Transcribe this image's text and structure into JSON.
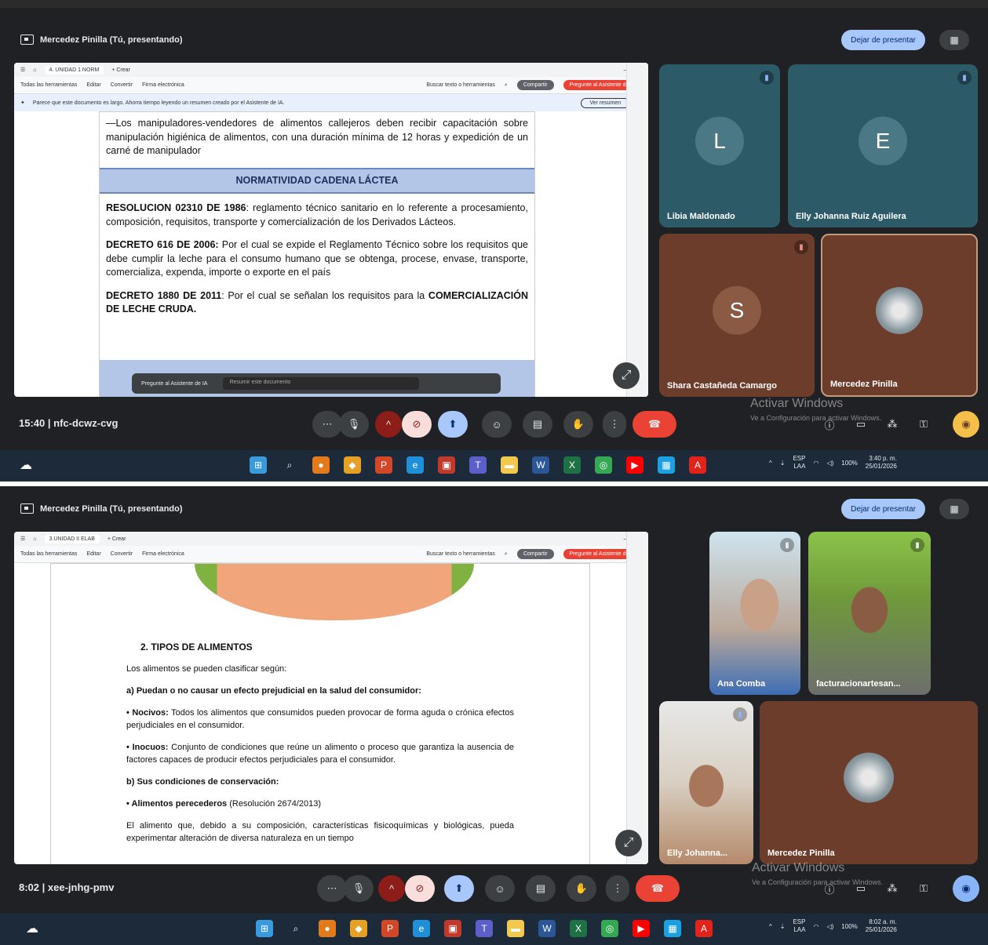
{
  "meeting_top": {
    "presenter_label": "Mercedez Pinilla (Tú, presentando)",
    "stop_presenting": "Dejar de presentar",
    "pdf": {
      "tab_label": "4. UNIDAD 1 NORM",
      "new_tab": "+ Crear",
      "toolbar_items": [
        "Todas las herramientas",
        "Editar",
        "Convertir",
        "Firma electrónica"
      ],
      "search_placeholder": "Buscar texto o herramientas",
      "share": "Compartir",
      "ask_ai": "Pregunte al Asistente de IA",
      "notice": "Parece que este documento es largo. Ahorra tiempo leyendo un resumen creado por el Asistente de IA.",
      "notice_button": "Ver resumen",
      "ask_bar_label": "Pregunte al Asistente de IA",
      "ask_bar_placeholder": "Resumir este documento"
    },
    "doc": {
      "intro": "—Los manipuladores-vendedores de alimentos callejeros deben recibir capacitación sobre manipulación higiénica de alimentos, con una duración mínima de 12 horas y expedición de un carné de manipulador",
      "heading": "NORMATIVIDAD CADENA LÁCTEA",
      "items": [
        {
          "bold": "RESOLUCION 02310 DE 1986",
          "text": ": reglamento técnico sanitario en lo referente a procesamiento, composición, requisitos, transporte y comercialización de los Derivados Lácteos."
        },
        {
          "bold": "DECRETO 616 DE 2006:",
          "text": " Por el cual se expide el Reglamento Técnico sobre los requisitos que debe cumplir la leche para el consumo humano que se obtenga, procese, envase, transporte, comercializa, expenda, importe o exporte en el país"
        },
        {
          "bold": "DECRETO 1880 DE 2011",
          "text": ": Por el cual se señalan los requisitos para la ",
          "bold2": "COMERCIALIZACIÓN DE LECHE CRUDA."
        }
      ]
    },
    "participants": [
      {
        "initial": "L",
        "name": "Libia Maldonado",
        "color": "#2d5a67"
      },
      {
        "initial": "E",
        "name": "Elly Johanna Ruiz Aguilera",
        "color": "#2d5a67"
      },
      {
        "initial": "S",
        "name": "Shara Castañeda Camargo",
        "color": "#6b3d2a"
      },
      {
        "initial": "",
        "name": "Mercedez Pinilla",
        "color": "#6b3d2a"
      }
    ],
    "time": "15:40",
    "meeting_code": "nfc-dcwz-cvg",
    "watermark_title": "Activar Windows",
    "watermark_sub": "Ve a Configuración para activar Windows.",
    "tray": {
      "lang1": "ESP",
      "lang2": "LAA",
      "battery": "100%",
      "clock_time": "3:40 p. m.",
      "clock_date": "25/01/2026"
    }
  },
  "meeting_bottom": {
    "presenter_label": "Mercedez Pinilla (Tú, presentando)",
    "stop_presenting": "Dejar de presentar",
    "pdf": {
      "tab_label": "3.UNIDAD II ELAB",
      "new_tab": "+ Crear",
      "toolbar_items": [
        "Todas las herramientas",
        "Editar",
        "Convertir",
        "Firma electrónica"
      ],
      "search_placeholder": "Buscar texto o herramientas",
      "share": "Compartir",
      "ask_ai": "Pregunte al Asistente de IA"
    },
    "doc": {
      "heading": "2.  TIPOS DE ALIMENTOS",
      "intro": "Los alimentos se pueden clasificar según:",
      "sub_a": "a) Puedan o no causar un efecto prejudicial en la salud del consumidor:",
      "nocivos_bold": "• Nocivos:",
      "nocivos_text": " Todos los alimentos que consumidos pueden provocar de forma aguda o crónica efectos perjudiciales en el consumidor.",
      "inocuos_bold": "• Inocuos:",
      "inocuos_text": " Conjunto de condiciones que reúne un alimento o proceso que garantiza la ausencia de factores capaces de producir efectos perjudiciales para el consumidor.",
      "sub_b": "b) Sus condiciones de conservación:",
      "perecederos_bold": "• Alimentos perecederos",
      "perecederos_text": " (Resolución 2674/2013)",
      "last": "El alimento que, debido a su composición, características fisicoquímicas y biológicas, pueda experimentar alteración de diversa naturaleza en un tiempo"
    },
    "participants": [
      {
        "name": "Ana Comba"
      },
      {
        "name": "facturacionartesan..."
      },
      {
        "name": "Elly Johanna..."
      },
      {
        "name": "Mercedez Pinilla"
      }
    ],
    "time": "8:02",
    "meeting_code": "xee-jnhg-pmv",
    "watermark_title": "Activar Windows",
    "watermark_sub": "Ve a Configuración para activar Windows.",
    "tray": {
      "lang1": "ESP",
      "lang2": "LAA",
      "battery": "100%",
      "clock_time": "8:02 a. m.",
      "clock_date": "25/01/2026"
    }
  }
}
